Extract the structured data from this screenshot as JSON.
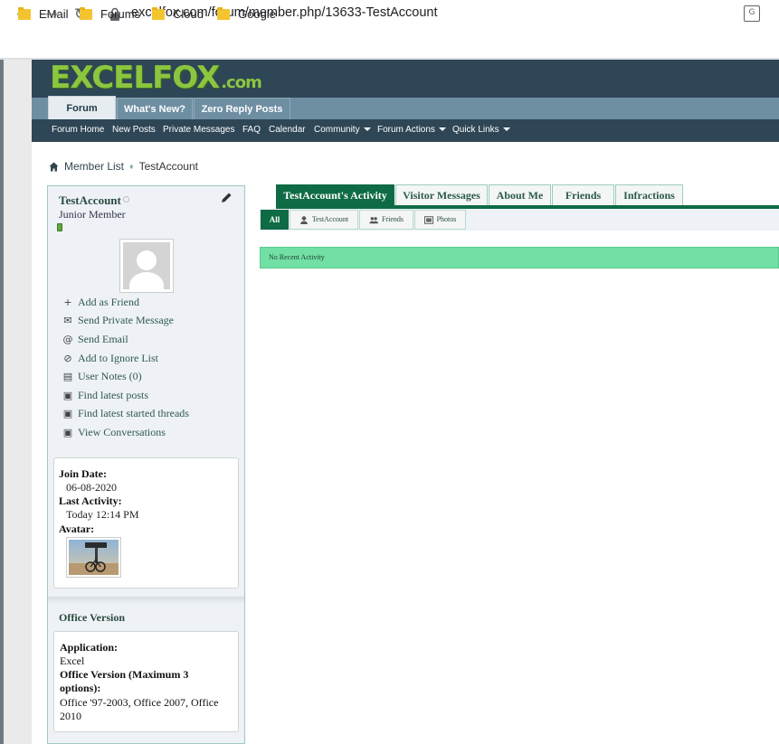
{
  "browser": {
    "url": "excelfox.com/forum/member.php/13633-TestAccount",
    "bookmarks": [
      "EMail",
      "Forums",
      "Cloud",
      "Google"
    ]
  },
  "site": {
    "logo_text": "EXCELFOX",
    "logo_suffix": ".com",
    "main_tabs": [
      "Forum",
      "What's New?",
      "Zero Reply Posts"
    ],
    "subnav": [
      "Forum Home",
      "New Posts",
      "Private Messages",
      "FAQ",
      "Calendar",
      "Community",
      "Forum Actions",
      "Quick Links"
    ]
  },
  "breadcrumb": {
    "parent": "Member List",
    "current": "TestAccount"
  },
  "profile": {
    "username": "TestAccount",
    "title": "Junior Member",
    "actions": [
      "Add as Friend",
      "Send Private Message",
      "Send Email",
      "Add to Ignore List",
      "User Notes (0)",
      "Find latest posts",
      "Find latest started threads",
      "View Conversations"
    ],
    "join_label": "Join Date:",
    "join_value": "06-08-2020",
    "activity_label": "Last Activity:",
    "activity_value": "Today 12:14 PM",
    "avatar_label": "Avatar:"
  },
  "office": {
    "title": "Office Version",
    "app_label": "Application:",
    "app_value": "Excel",
    "version_label": "Office Version (Maximum 3 options):",
    "version_value": "Office '97-2003, Office 2007, Office 2010"
  },
  "tabs": [
    "TestAccount's Activity",
    "Visitor Messages",
    "About Me",
    "Friends",
    "Infractions"
  ],
  "subtabs": [
    "All",
    "TestAccount",
    "Friends",
    "Photos"
  ],
  "activity_message": "No Recent Activity",
  "colors": {
    "accent": "#0e6b45",
    "header": "#2e4656",
    "activity": "#72e0a4"
  }
}
